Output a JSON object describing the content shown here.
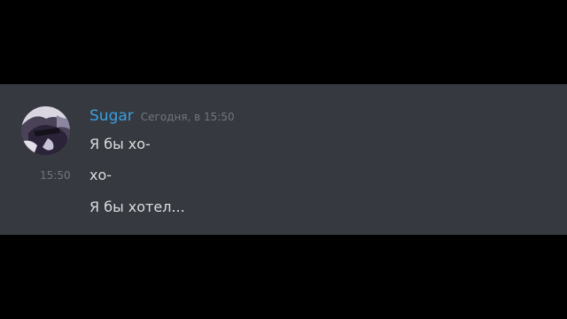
{
  "message_group": {
    "username": "Sugar",
    "timestamp": "Сегодня, в 15:50",
    "side_timestamp": "15:50",
    "messages": [
      "Я бы хо-",
      "хо-",
      "Я бы хотел..."
    ]
  },
  "colors": {
    "background": "#36393f",
    "letterbox": "#000000",
    "username": "#3a9fe0",
    "text": "#dcddde",
    "muted": "#72767d"
  },
  "avatar": {
    "icon": "anime-character-avatar"
  }
}
